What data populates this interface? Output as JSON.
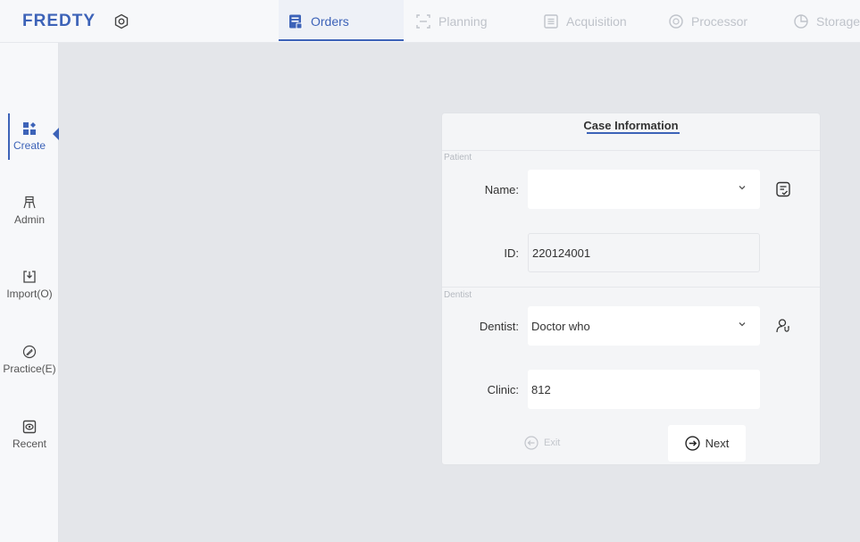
{
  "header": {
    "logo": "FREDTY",
    "settings_icon": "gear-icon",
    "tabs": [
      {
        "label": "Orders",
        "icon": "orders-icon",
        "active": true
      },
      {
        "label": "Planning",
        "icon": "planning-icon",
        "active": false
      },
      {
        "label": "Acquisition",
        "icon": "acquisition-icon",
        "active": false
      },
      {
        "label": "Processor",
        "icon": "processor-icon",
        "active": false
      },
      {
        "label": "Storage",
        "icon": "storage-icon",
        "active": false
      }
    ]
  },
  "sidebar": {
    "items": [
      {
        "label": "Create",
        "icon": "create-icon",
        "active": true
      },
      {
        "label": "Admin",
        "icon": "admin-icon",
        "active": false
      },
      {
        "label": "Import(O)",
        "icon": "import-icon",
        "active": false
      },
      {
        "label": "Practice(E)",
        "icon": "practice-icon",
        "active": false
      },
      {
        "label": "Recent",
        "icon": "recent-icon",
        "active": false
      }
    ]
  },
  "card": {
    "title": "Case Information",
    "patient_section": "Patient",
    "dentist_section": "Dentist",
    "fields": {
      "name": {
        "label": "Name:",
        "value": ""
      },
      "id": {
        "label": "ID:",
        "value": "220124001"
      },
      "dentist": {
        "label": "Dentist:",
        "value": "Doctor who"
      },
      "clinic": {
        "label": "Clinic:",
        "value": "812"
      }
    },
    "exit_label": "Exit",
    "next_label": "Next"
  },
  "colors": {
    "accent": "#3d63b8",
    "background": "#e4e6ea",
    "panel": "#f4f5f7",
    "inactive_text": "#bfc3ca"
  }
}
